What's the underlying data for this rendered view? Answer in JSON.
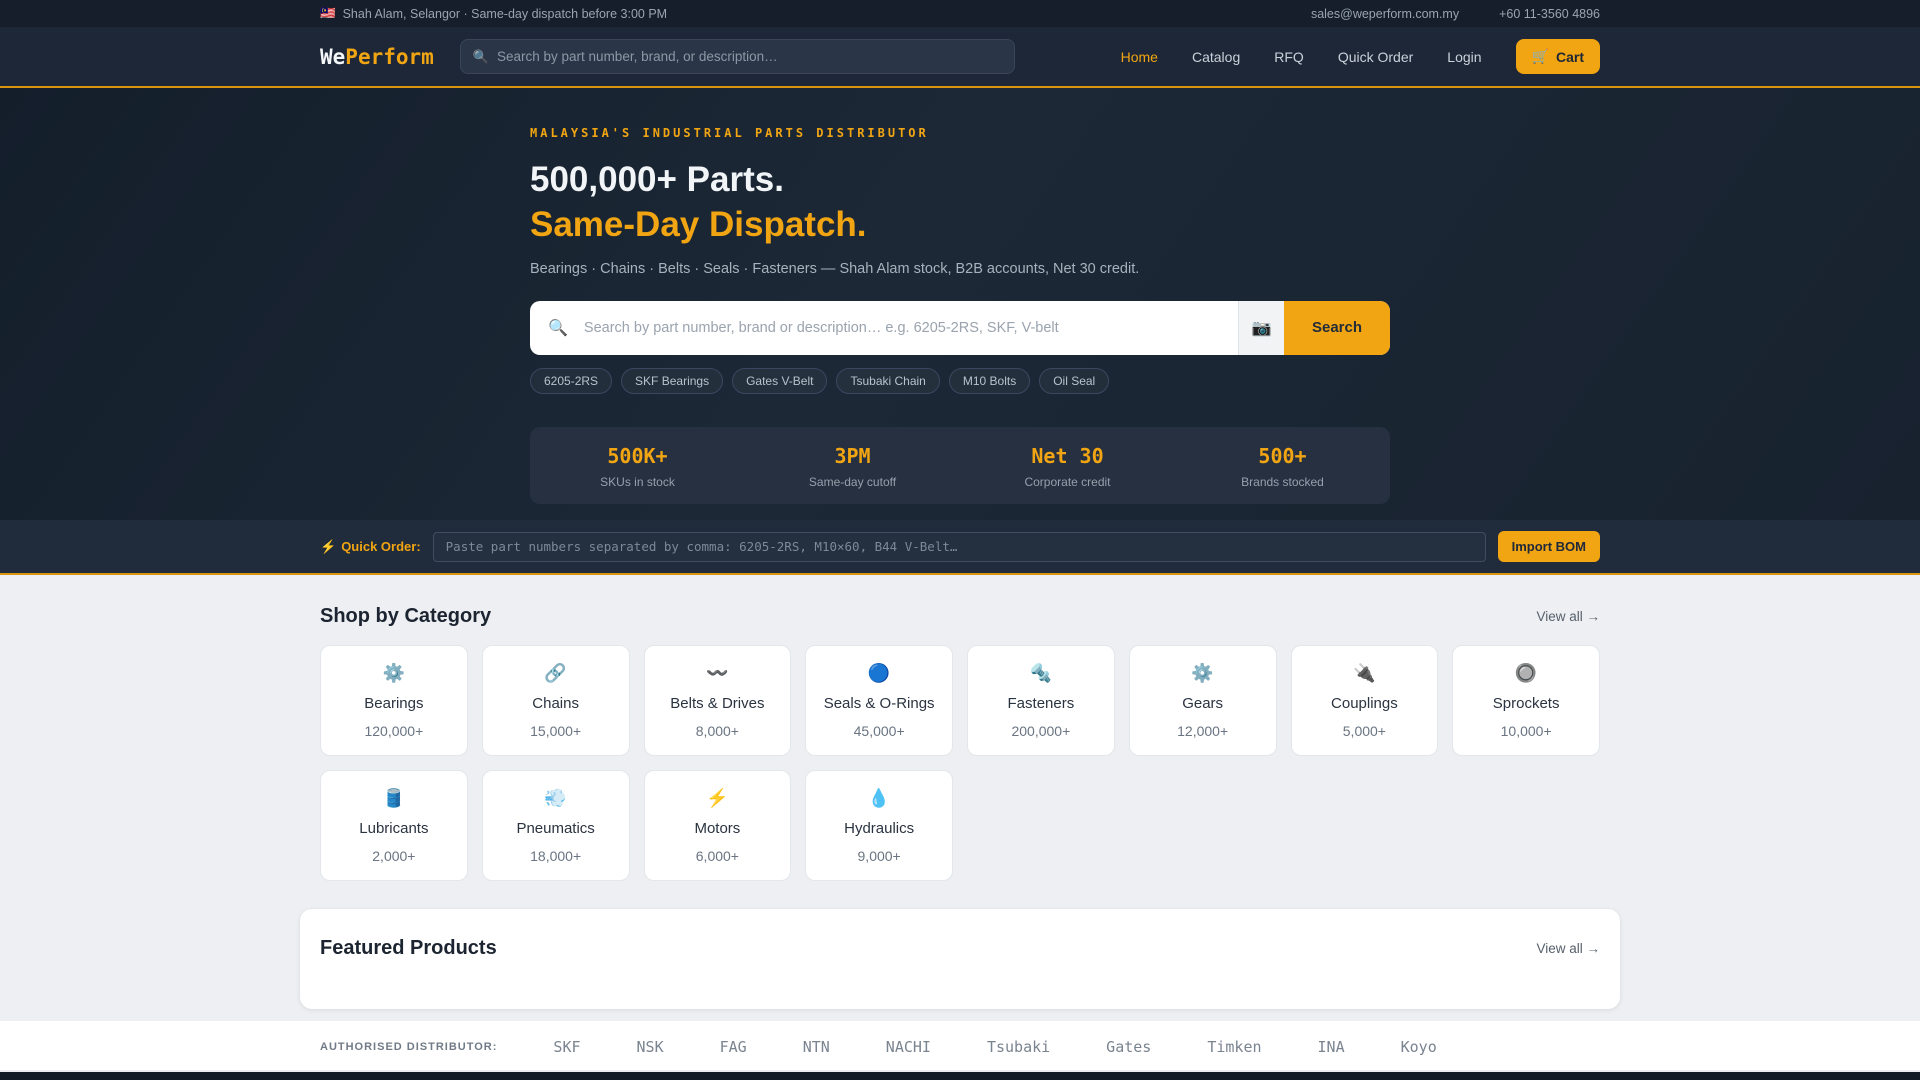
{
  "colors": {
    "accent": "#F1A512",
    "header_bg": "#1D2737",
    "topbar_bg": "#151E2A",
    "page_bg": "#EDEFF2"
  },
  "topbar": {
    "flag_icon": "🇲🇾",
    "location": "Shah Alam, Selangor · Same-day dispatch before 3:00 PM",
    "email": "sales@weperform.com.my",
    "phone": "+60 11-3560 4896"
  },
  "header": {
    "logo_we": "We",
    "logo_perform": "Perform",
    "search_icon": "🔍",
    "search_placeholder": "Search by part number, brand, or description…",
    "nav": [
      "Home",
      "Catalog",
      "RFQ",
      "Quick Order",
      "Login"
    ],
    "cart": {
      "icon": "🛒",
      "label": "Cart"
    }
  },
  "hero": {
    "eyebrow": "MALAYSIA'S INDUSTRIAL PARTS DISTRIBUTOR",
    "title_line1": "500,000+ Parts.",
    "title_line2": "Same-Day Dispatch.",
    "subtitle": "Bearings · Chains · Belts · Seals · Fasteners — Shah Alam stock, B2B accounts, Net 30 credit.",
    "search": {
      "icon": "🔍",
      "placeholder": "Search by part number, brand or description… e.g. 6205-2RS, SKF, V-belt",
      "camera_icon": "📷",
      "button_label": "Search"
    },
    "chips": [
      "6205-2RS",
      "SKF Bearings",
      "Gates V-Belt",
      "Tsubaki Chain",
      "M10 Bolts",
      "Oil Seal"
    ],
    "stats": [
      {
        "value": "500K+",
        "label": "SKUs in stock"
      },
      {
        "value": "3PM",
        "label": "Same-day cutoff"
      },
      {
        "value": "Net 30",
        "label": "Corporate credit"
      },
      {
        "value": "500+",
        "label": "Brands stocked"
      }
    ]
  },
  "quick_order": {
    "icon": "⚡",
    "label": "Quick Order:",
    "placeholder": "Paste part numbers separated by comma: 6205-2RS, M10×60, B44 V-Belt…",
    "button_label": "Import BOM"
  },
  "categories": {
    "heading": "Shop by Category",
    "view_all": "View all →",
    "items": [
      {
        "icon": "⚙️",
        "name": "Bearings",
        "count": "120,000+"
      },
      {
        "icon": "🔗",
        "name": "Chains",
        "count": "15,000+"
      },
      {
        "icon": "〰️",
        "name": "Belts & Drives",
        "count": "8,000+"
      },
      {
        "icon": "🔵",
        "name": "Seals & O-Rings",
        "count": "45,000+"
      },
      {
        "icon": "🔩",
        "name": "Fasteners",
        "count": "200,000+"
      },
      {
        "icon": "⚙️",
        "name": "Gears",
        "count": "12,000+"
      },
      {
        "icon": "🔌",
        "name": "Couplings",
        "count": "5,000+"
      },
      {
        "icon": "🔘",
        "name": "Sprockets",
        "count": "10,000+"
      },
      {
        "icon": "🛢️",
        "name": "Lubricants",
        "count": "2,000+"
      },
      {
        "icon": "💨",
        "name": "Pneumatics",
        "count": "18,000+"
      },
      {
        "icon": "⚡",
        "name": "Motors",
        "count": "6,000+"
      },
      {
        "icon": "💧",
        "name": "Hydraulics",
        "count": "9,000+"
      }
    ]
  },
  "featured": {
    "heading": "Featured Products",
    "view_all": "View all →"
  },
  "brands": {
    "label": "AUTHORISED DISTRIBUTOR:",
    "items": [
      "SKF",
      "NSK",
      "FAG",
      "NTN",
      "NACHI",
      "Tsubaki",
      "Gates",
      "Timken",
      "INA",
      "Koyo"
    ]
  }
}
